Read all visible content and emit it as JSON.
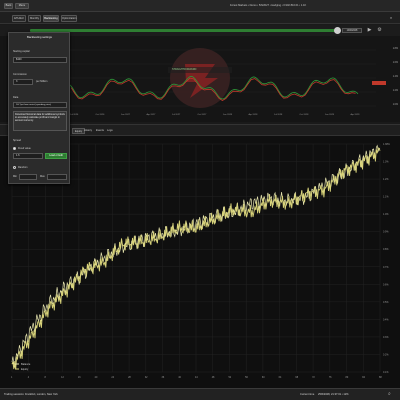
{
  "topbar": {
    "back_label": "Back",
    "menu_label": "Menu",
    "info": "Forest Markets • Demo • 5/6/2027 • Hedging • 0.902 810.01 • 1.1K"
  },
  "tabs": [
    {
      "label": "ETH/EU"
    },
    {
      "label": "Monthly"
    },
    {
      "label": "Backtesting"
    },
    {
      "label": "Optimization"
    }
  ],
  "timeline": {
    "label": "Trading Area",
    "end_date": "19/9/2028"
  },
  "panel": {
    "title": "Backtesting settings",
    "starting_capital_label": "Starting capital",
    "starting_capital_value": "$100",
    "commission_label": "Commission",
    "commission_value": "3",
    "commission_unit": "per Million",
    "data_label": "Data",
    "data_value": "1H Tpst from assist (speeding price)",
    "note": "Download historical data for additional symbols to accurately calculate profit and margin in account currency.",
    "spread_label": "Spread",
    "fixed_value_label": "Fixed value",
    "fixed_value": "1.6",
    "apply_label": "Load or Edit",
    "random_label": "Random",
    "min_label": "Min",
    "max_label": "Max"
  },
  "minichart": {
    "watermark": "STRAIGHTFORWARD",
    "price_labels": [
      "1.8%",
      "1.6%",
      "1.4%",
      "1.2%",
      "1.0%"
    ],
    "time_labels": [
      "Jul 2026",
      "Oct 2026",
      "Jan 2027",
      "Apr 2027",
      "Jul 2027",
      "Oct 2027",
      "Jan 2028",
      "Apr 2028",
      "Jul 2028",
      "Oct 2028",
      "Jan 2029",
      "Apr 2029"
    ]
  },
  "lower_tabs": [
    {
      "label": "Equity"
    },
    {
      "label": "History"
    },
    {
      "label": "Events"
    },
    {
      "label": "Logs"
    }
  ],
  "status": {
    "left": "Trading sessions: Frankfurt, London, New York",
    "right_label": "Current time",
    "right_value": "25/6/2028, 21:37:01 • 12%",
    "zoom_icon": "search-icon"
  },
  "colors": {
    "equity": "#d8d37a",
    "balance": "#e8e6b0",
    "timeline_green": "#2e7d32"
  },
  "chart_data": {
    "type": "line",
    "title": "",
    "xlabel": "",
    "ylabel": "",
    "x": [
      0,
      5,
      10,
      15,
      20,
      25,
      30,
      35,
      40,
      45,
      50,
      55,
      60,
      65,
      70,
      75,
      80,
      85,
      90,
      95,
      100
    ],
    "ylim": [
      0,
      100
    ],
    "series": [
      {
        "name": "Balance",
        "values": [
          3,
          18,
          30,
          38,
          44,
          50,
          55,
          58,
          60,
          62,
          65,
          68,
          70,
          74,
          76,
          75,
          77,
          82,
          87,
          93,
          98
        ]
      },
      {
        "name": "Equity",
        "values": [
          2,
          15,
          28,
          36,
          45,
          48,
          56,
          57,
          59,
          63,
          63,
          67,
          71,
          70,
          75,
          74,
          78,
          80,
          88,
          92,
          97
        ]
      }
    ],
    "legend_position": "bottom-left",
    "y_tick_labels": [
      "1.38%",
      "1.3%",
      "1.2%",
      "1.1%",
      "1.0%",
      "0.9%",
      "0.8%",
      "0.7%",
      "0.6%",
      "0.5%",
      "0.4%",
      "0.3%",
      "0.2%",
      "0.1%"
    ],
    "x_tick_labels": [
      "1",
      "4",
      "8",
      "12",
      "16",
      "20",
      "24",
      "28",
      "32",
      "36",
      "40",
      "44",
      "48",
      "52",
      "56",
      "60",
      "64",
      "68",
      "72",
      "76",
      "80",
      "84",
      "88"
    ]
  }
}
